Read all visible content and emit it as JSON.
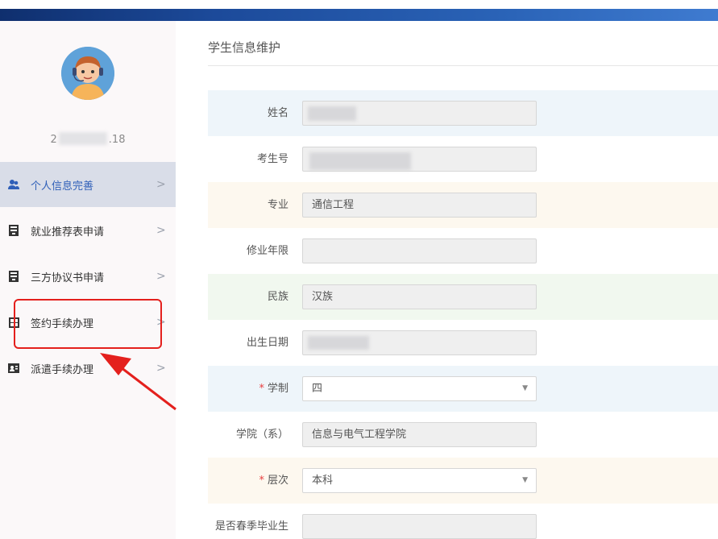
{
  "colors": {
    "header_bar": "#1c4a9a",
    "sidebar_bg": "#fbf8f9",
    "active_item_bg": "#d9dde8",
    "active_item_text": "#2f5fb8",
    "highlight": "#e4201d",
    "row_blue": "#eef5fa",
    "row_cream": "#fdf8ef",
    "row_green": "#f1f8ef",
    "required": "#e84040"
  },
  "user": {
    "id_prefix": "2",
    "id_suffix": ".18"
  },
  "sidebar": {
    "items": [
      {
        "label": "个人信息完善",
        "icon": "user-icon",
        "active": true
      },
      {
        "label": "就业推荐表申请",
        "icon": "document-icon",
        "active": false
      },
      {
        "label": "三方协议书申请",
        "icon": "document-icon",
        "active": false
      },
      {
        "label": "签约手续办理",
        "icon": "grid-document-icon",
        "active": false
      },
      {
        "label": "派遣手续办理",
        "icon": "id-card-icon",
        "active": false
      }
    ],
    "chevron": ">"
  },
  "main": {
    "title": "学生信息维护",
    "form": [
      {
        "label": "姓名",
        "value": "",
        "required": false,
        "type": "text"
      },
      {
        "label": "考生号",
        "value": "",
        "required": false,
        "type": "text"
      },
      {
        "label": "专业",
        "value": "通信工程",
        "required": false,
        "type": "text"
      },
      {
        "label": "修业年限",
        "value": "",
        "required": false,
        "type": "text"
      },
      {
        "label": "民族",
        "value": "汉族",
        "required": false,
        "type": "text"
      },
      {
        "label": "出生日期",
        "value": "",
        "required": false,
        "type": "text"
      },
      {
        "label": "学制",
        "value": "四",
        "required": true,
        "type": "select"
      },
      {
        "label": "学院（系）",
        "value": "信息与电气工程学院",
        "required": false,
        "type": "text"
      },
      {
        "label": "层次",
        "value": "本科",
        "required": true,
        "type": "select"
      },
      {
        "label": "是否春季毕业生",
        "value": "",
        "required": false,
        "type": "text"
      }
    ],
    "required_mark": "*",
    "select_caret": "▼"
  }
}
